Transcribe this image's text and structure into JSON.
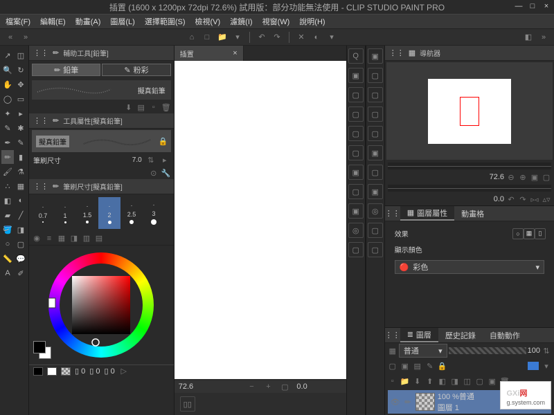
{
  "title": "插置 (1600 x 1200px 72dpi 72.6%)  試用版：部分功能無法使用 - CLIP STUDIO PAINT PRO",
  "menu": [
    "檔案(F)",
    "編輯(E)",
    "動畫(A)",
    "圖層(L)",
    "選擇範圍(S)",
    "檢視(V)",
    "濾鏡(I)",
    "視窗(W)",
    "說明(H)"
  ],
  "subtool_panel": {
    "title": "輔助工具[鉛筆]",
    "tab1": "鉛筆",
    "tab2": "粉彩",
    "brush_name": "擬真鉛筆"
  },
  "tool_prop": {
    "title": "工具屬性[擬真鉛筆]",
    "preset": "擬真鉛筆",
    "size_label": "筆刷尺寸",
    "size_val": "7.0"
  },
  "brush_size": {
    "title": "筆刷尺寸[擬真鉛筆]",
    "sizes": [
      "0.7",
      "1",
      "1.5",
      "2",
      "2.5",
      "3"
    ]
  },
  "canvas_tab": "插置",
  "canvas_status": {
    "zoom": "72.6",
    "xy": "0.0"
  },
  "navigator": {
    "title": "導航器",
    "zoom": "72.6",
    "rotate": "0.0"
  },
  "layer_prop": {
    "tab1": "圖層屬性",
    "tab2": "動畫格",
    "effect": "效果",
    "show_color": "顯示顏色",
    "color_mode": "彩色"
  },
  "layers": {
    "tab1": "圖層",
    "tab2": "歷史記錄",
    "tab3": "自動動作",
    "blend": "普通",
    "opacity": "100",
    "layer1_opacity": "100 %普通",
    "layer1_name": "圖層 1"
  },
  "bottom": {
    "v1": "0",
    "v2": "0",
    "v3": "0"
  },
  "watermark": {
    "brand": "GXi",
    "sub": "g.system.com"
  }
}
